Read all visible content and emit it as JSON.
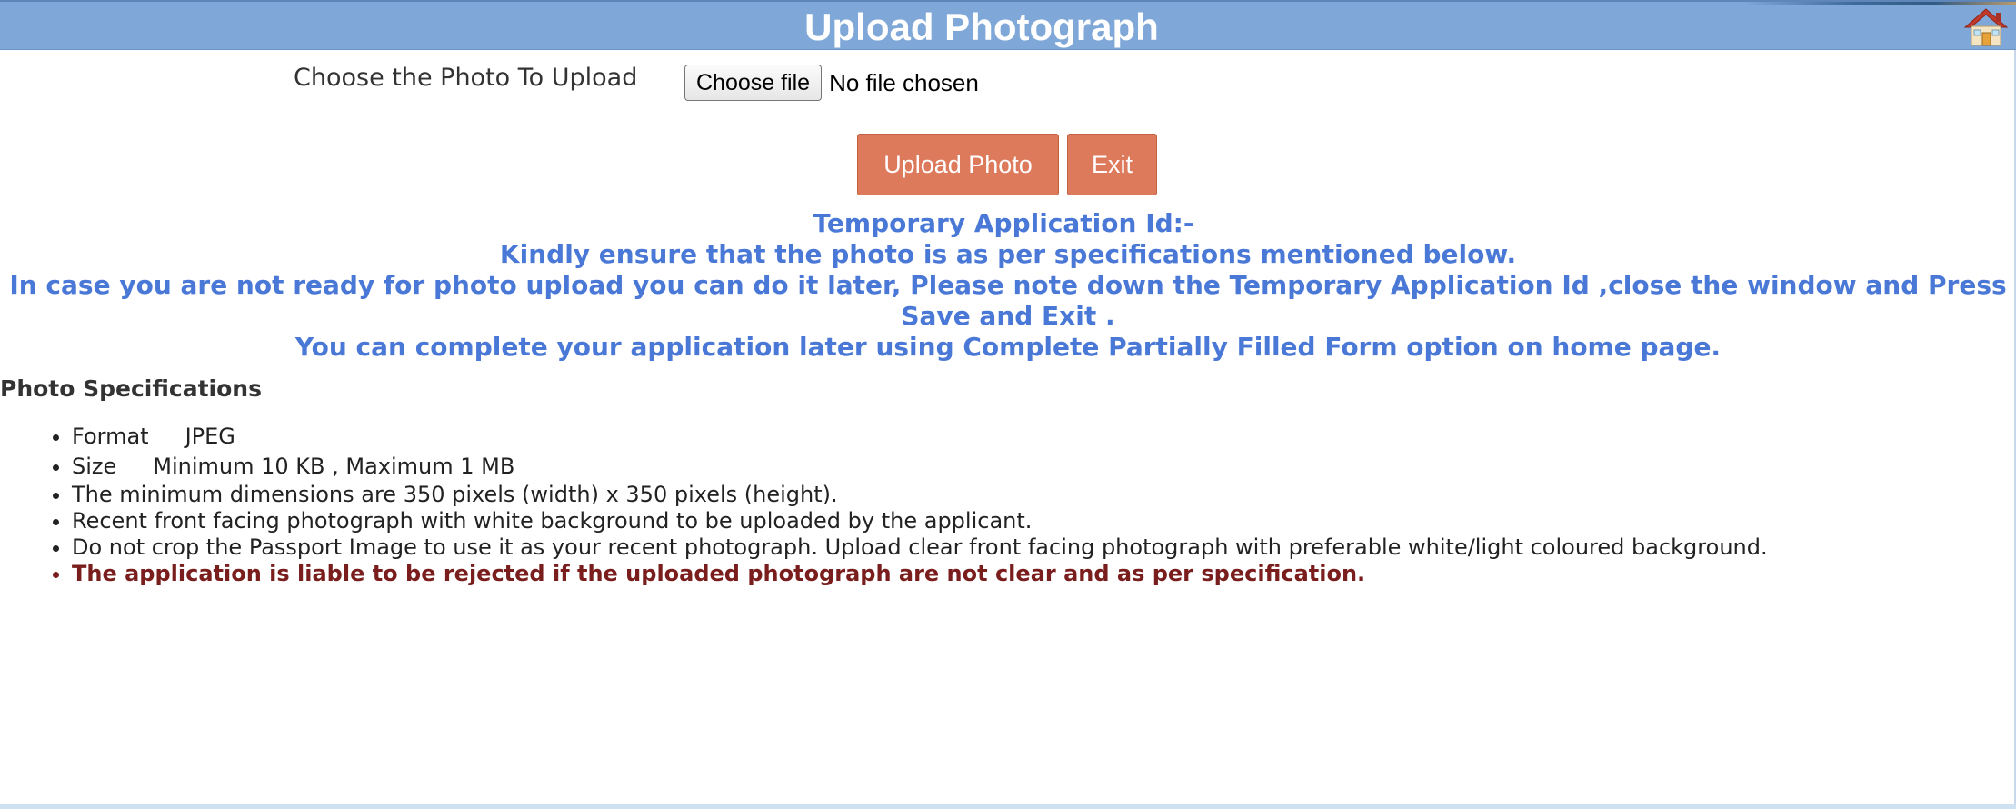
{
  "header": {
    "title": "Upload Photograph",
    "home_icon": "home-icon"
  },
  "upload": {
    "label": "Choose the Photo To Upload",
    "choose_button": "Choose file",
    "file_status": "No file chosen"
  },
  "actions": {
    "upload_photo": "Upload Photo",
    "exit": "Exit"
  },
  "messages": {
    "temp_id_label": "Temporary Application Id:-",
    "temp_id_value": "",
    "ensure": "Kindly ensure that the photo is as per specifications mentioned below.",
    "not_ready": "In case you are not ready for photo upload you can do it later, Please note down the Temporary Application Id ,close the window and Press Save and Exit .",
    "complete_later": "You can complete your application later using Complete Partially Filled Form option on home page."
  },
  "specifications": {
    "heading": "Photo Specifications",
    "format_key": "Format",
    "format_value": "JPEG",
    "size_key": "Size",
    "size_value": "Minimum 10 KB , Maximum 1 MB",
    "dimensions": "The minimum dimensions are 350 pixels (width) x 350 pixels (height).",
    "front_facing": "Recent front facing photograph with white background to be uploaded by the applicant.",
    "no_crop": "Do not crop the Passport Image to use it as your recent photograph. Upload clear front facing photograph with preferable white/light coloured background.",
    "warning": "The application is liable to be rejected if the uploaded photograph are not clear and as per specification."
  },
  "colors": {
    "header_bg": "#7fa8d8",
    "button_bg": "#de7a5c",
    "info_text": "#4a78d6",
    "warning_text": "#7a1d1d"
  }
}
